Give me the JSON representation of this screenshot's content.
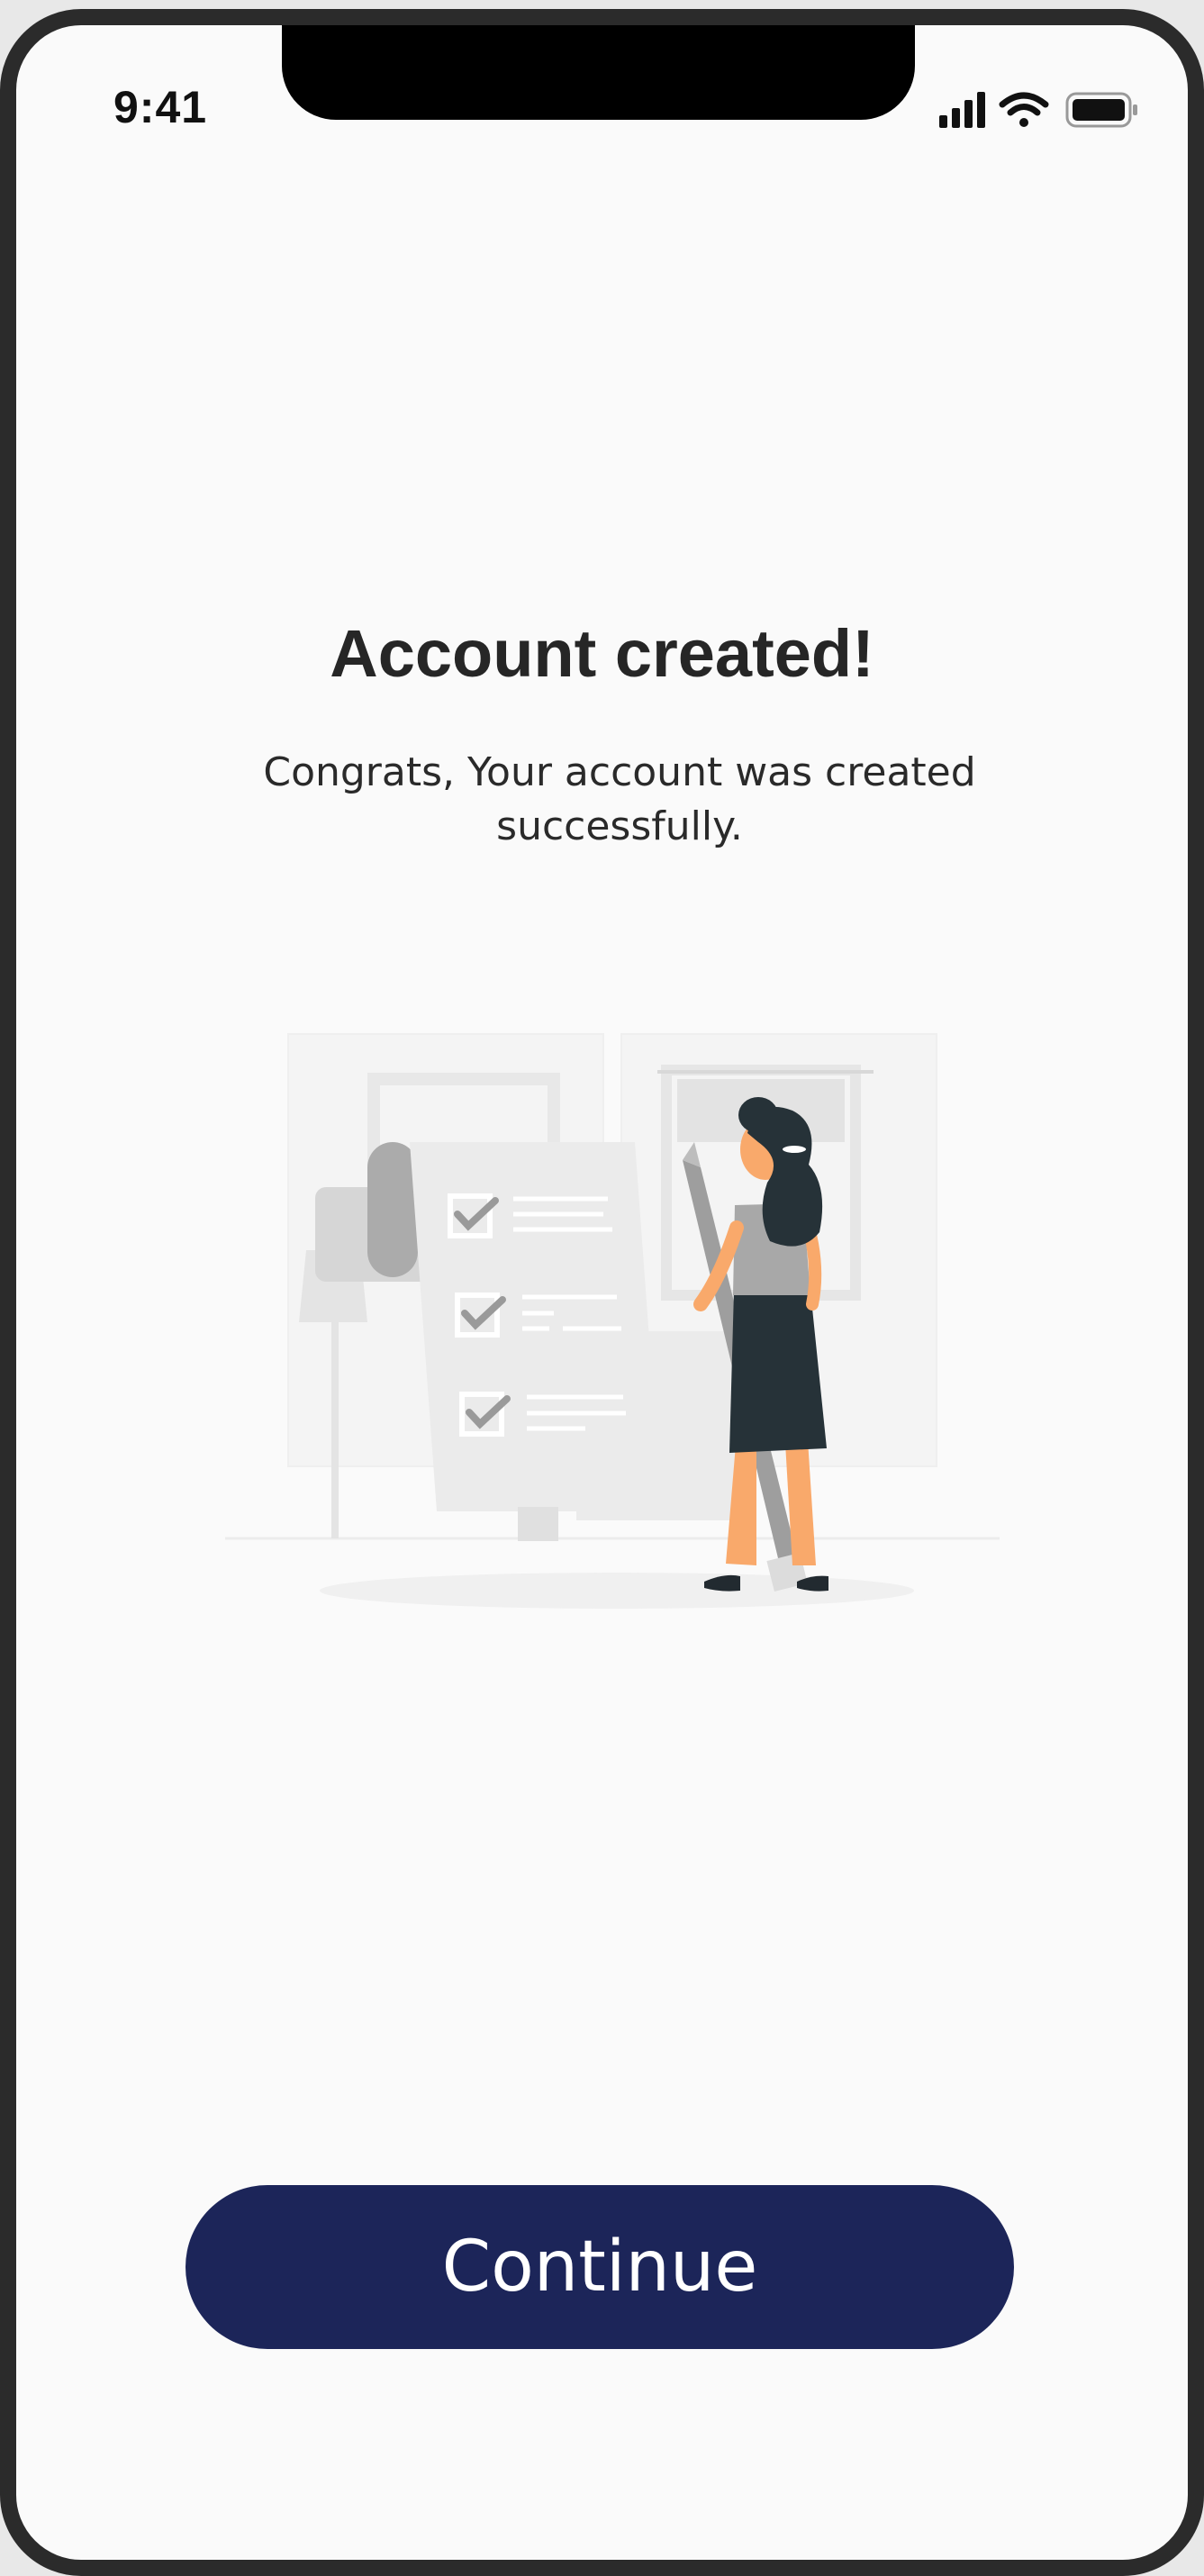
{
  "status_bar": {
    "time": "9:41",
    "icons": [
      "cellular-signal-icon",
      "wifi-icon",
      "battery-icon"
    ]
  },
  "main": {
    "title": "Account created!",
    "subtitle": "Congrats, Your account was created successfully.",
    "illustration": "checklist-illustration"
  },
  "actions": {
    "continue_label": "Continue"
  },
  "colors": {
    "primary": "#1c2559",
    "background": "#fafafa",
    "frame": "#2b2b2b"
  }
}
